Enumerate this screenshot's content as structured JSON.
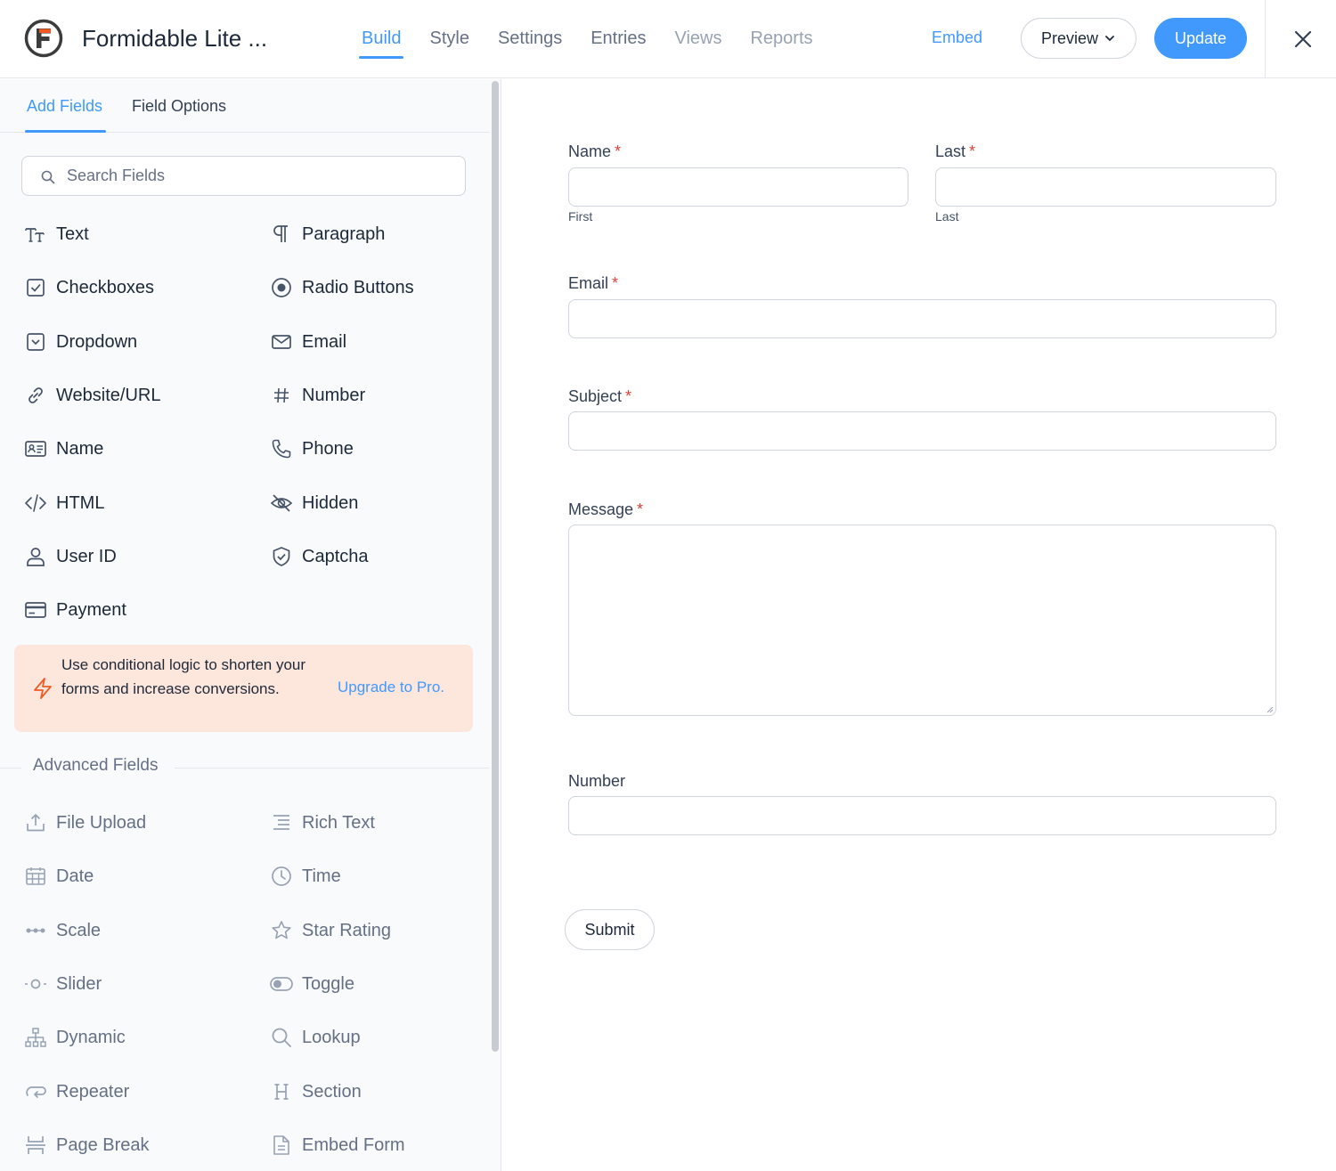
{
  "header": {
    "form_title": "Formidable Lite ...",
    "nav": [
      {
        "label": "Build",
        "state": "active"
      },
      {
        "label": "Style",
        "state": "normal"
      },
      {
        "label": "Settings",
        "state": "normal"
      },
      {
        "label": "Entries",
        "state": "normal"
      },
      {
        "label": "Views",
        "state": "disabled"
      },
      {
        "label": "Reports",
        "state": "disabled"
      }
    ],
    "embed_label": "Embed",
    "preview_label": "Preview",
    "update_label": "Update"
  },
  "sidebar": {
    "tabs": [
      {
        "label": "Add Fields",
        "active": true
      },
      {
        "label": "Field Options",
        "active": false
      }
    ],
    "search_placeholder": "Search Fields",
    "fields": [
      {
        "label": "Text",
        "icon": "text-icon"
      },
      {
        "label": "Paragraph",
        "icon": "paragraph-icon"
      },
      {
        "label": "Checkboxes",
        "icon": "checkbox-icon"
      },
      {
        "label": "Radio Buttons",
        "icon": "radio-icon"
      },
      {
        "label": "Dropdown",
        "icon": "dropdown-icon"
      },
      {
        "label": "Email",
        "icon": "envelope-icon"
      },
      {
        "label": "Website/URL",
        "icon": "link-icon"
      },
      {
        "label": "Number",
        "icon": "hash-icon"
      },
      {
        "label": "Name",
        "icon": "id-card-icon"
      },
      {
        "label": "Phone",
        "icon": "phone-icon"
      },
      {
        "label": "HTML",
        "icon": "code-icon"
      },
      {
        "label": "Hidden",
        "icon": "eye-off-icon"
      },
      {
        "label": "User ID",
        "icon": "user-icon"
      },
      {
        "label": "Captcha",
        "icon": "shield-icon"
      },
      {
        "label": "Payment",
        "icon": "credit-card-icon"
      }
    ],
    "promo": {
      "text": "Use conditional logic to shorten your forms and increase conversions.",
      "link": "Upgrade to Pro."
    },
    "advanced_heading": "Advanced Fields",
    "advanced_fields": [
      {
        "label": "File Upload",
        "icon": "upload-icon"
      },
      {
        "label": "Rich Text",
        "icon": "rich-text-icon"
      },
      {
        "label": "Date",
        "icon": "calendar-icon"
      },
      {
        "label": "Time",
        "icon": "clock-icon"
      },
      {
        "label": "Scale",
        "icon": "scale-icon"
      },
      {
        "label": "Star Rating",
        "icon": "star-icon"
      },
      {
        "label": "Slider",
        "icon": "slider-icon"
      },
      {
        "label": "Toggle",
        "icon": "toggle-icon"
      },
      {
        "label": "Dynamic",
        "icon": "hierarchy-icon"
      },
      {
        "label": "Lookup",
        "icon": "magnifier-icon"
      },
      {
        "label": "Repeater",
        "icon": "repeat-icon"
      },
      {
        "label": "Section",
        "icon": "heading-icon"
      },
      {
        "label": "Page Break",
        "icon": "page-break-icon"
      },
      {
        "label": "Embed Form",
        "icon": "file-icon"
      }
    ]
  },
  "form": {
    "name_label": "Name",
    "last_label": "Last",
    "first_sublabel": "First",
    "last_sublabel": "Last",
    "email_label": "Email",
    "subject_label": "Subject",
    "message_label": "Message",
    "number_label": "Number",
    "required_mark": "*",
    "submit_label": "Submit"
  },
  "colors": {
    "accent": "#4199fd",
    "required": "#e0403a",
    "promo_bg": "#fde6dc",
    "promo_icon": "#f15a24"
  }
}
